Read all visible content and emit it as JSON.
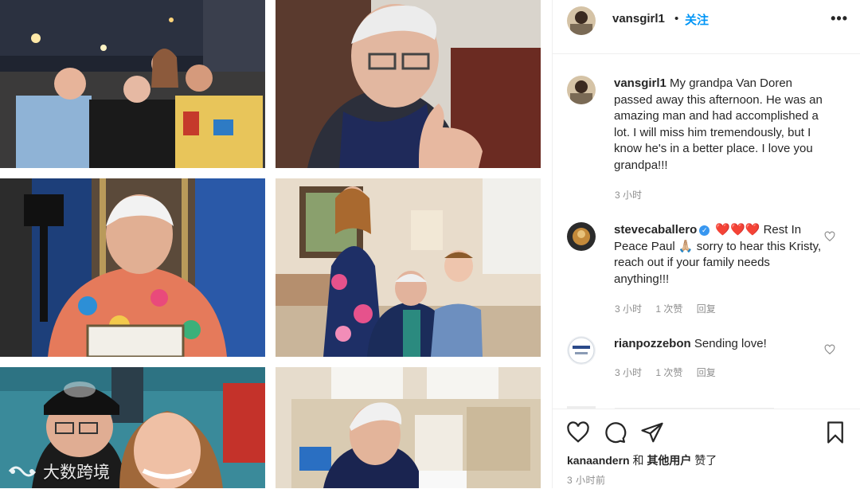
{
  "post": {
    "username": "vansgirl1",
    "separator": "•",
    "follow_label": "关注",
    "more_label": "•••",
    "caption": "My grandpa Van Doren passed away this afternoon. He was an amazing man and had accomplished a lot. I will miss him tremendously, but I know he's in a better place. I love you grandpa!!!",
    "caption_time": "3 小时"
  },
  "comments": [
    {
      "username": "stevecaballero",
      "verified": true,
      "text": "❤️❤️❤️ Rest In Peace Paul 🙏🏼 sorry to hear this Kristy, reach out if your family needs anything!!!",
      "time": "3 小时",
      "likes": "1 次赞",
      "reply": "回复"
    },
    {
      "username": "rianpozzebon",
      "verified": false,
      "text": "Sending love!",
      "time": "3 小时",
      "likes": "1 次赞",
      "reply": "回复"
    }
  ],
  "liked_by": {
    "user": "kanaandern",
    "conj": "和",
    "others": "其他用户",
    "suffix": "赞了"
  },
  "post_time": "3 小时前",
  "watermark": "大数跨境",
  "icons": [
    "heart-icon",
    "comment-icon",
    "share-icon",
    "bookmark-icon",
    "more-icon",
    "verified-icon"
  ]
}
